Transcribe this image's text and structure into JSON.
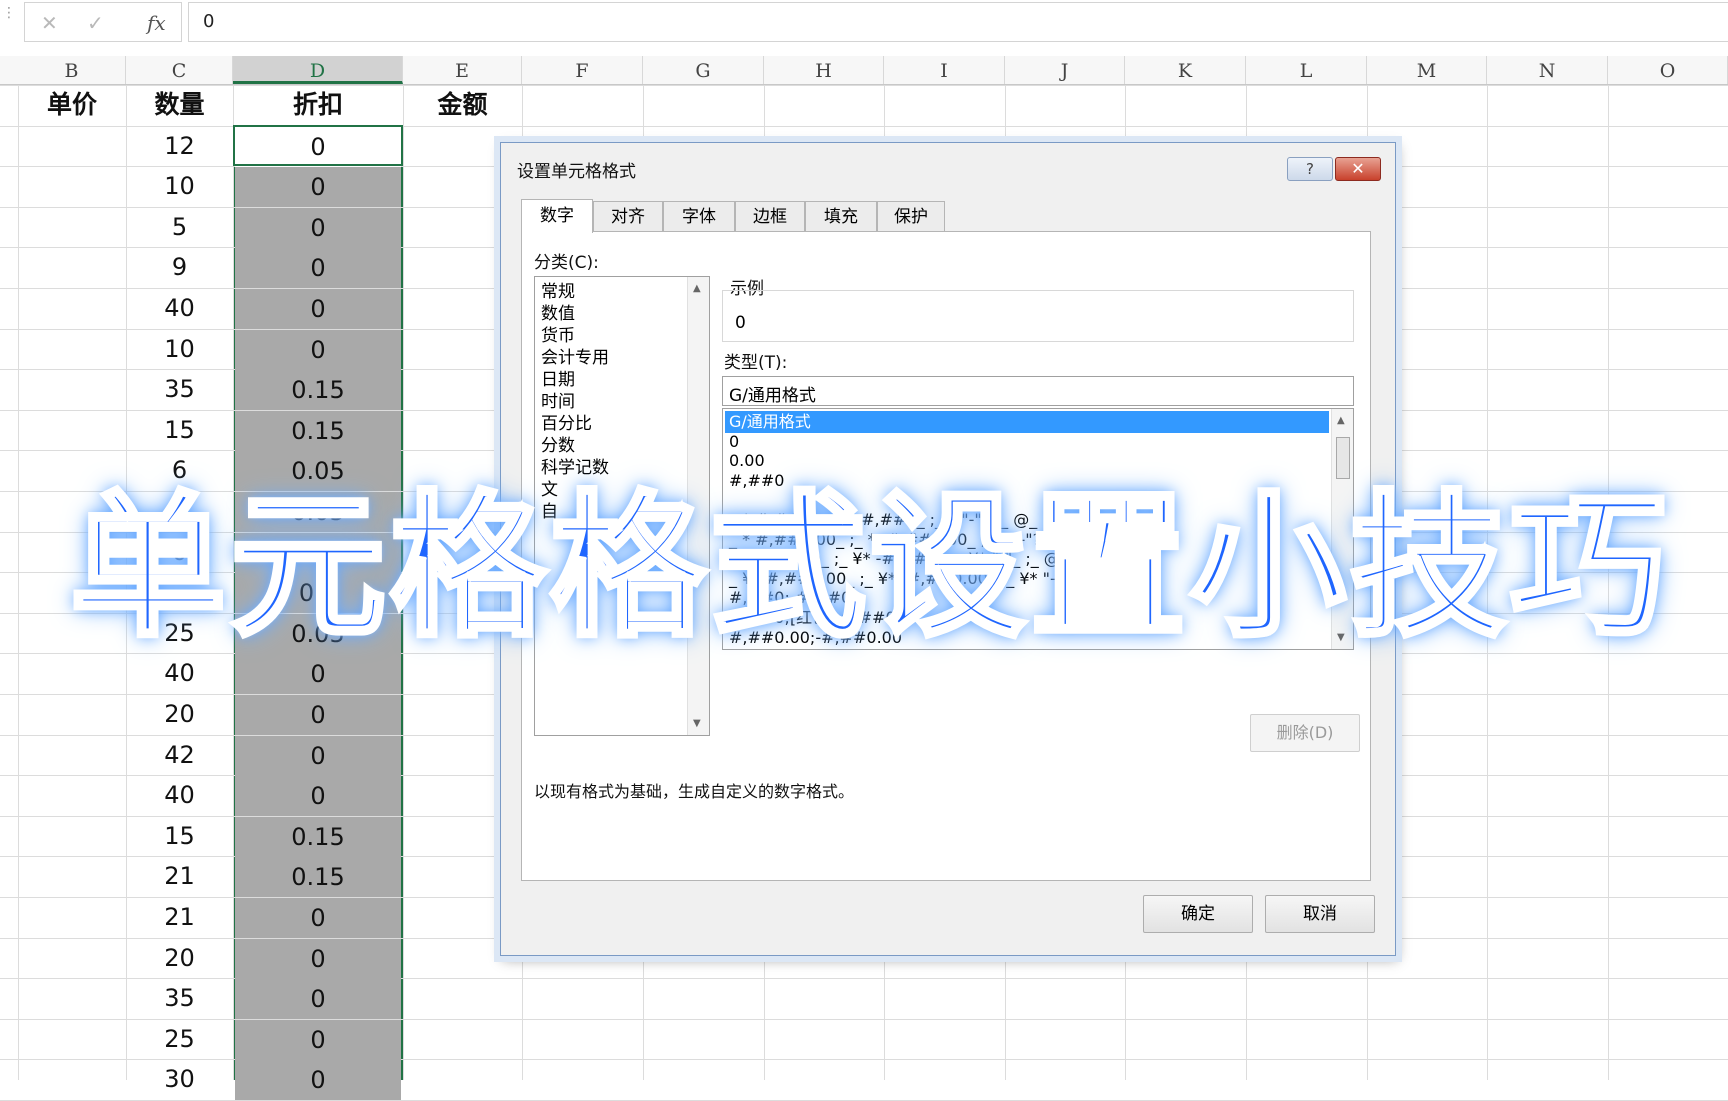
{
  "formula_bar": {
    "cancel_icon": "✕",
    "enter_icon": "✓",
    "fx_label": "fx",
    "value": "0"
  },
  "columns": [
    "B",
    "C",
    "D",
    "E",
    "F",
    "G",
    "H",
    "I",
    "J",
    "K",
    "L",
    "M",
    "N",
    "O"
  ],
  "selected_column": "D",
  "header_row": {
    "B": "单价",
    "C": "数量",
    "D": "折扣",
    "E": "金额"
  },
  "rows": [
    {
      "c": "12",
      "d": "0"
    },
    {
      "c": "10",
      "d": "0"
    },
    {
      "c": "5",
      "d": "0"
    },
    {
      "c": "9",
      "d": "0"
    },
    {
      "c": "40",
      "d": "0"
    },
    {
      "c": "10",
      "d": "0"
    },
    {
      "c": "35",
      "d": "0.15"
    },
    {
      "c": "15",
      "d": "0.15"
    },
    {
      "c": "6",
      "d": "0.05"
    },
    {
      "c": "5",
      "d": "0.05"
    },
    {
      "c": "0",
      "d": ""
    },
    {
      "c": "",
      "d": "0.1"
    },
    {
      "c": "25",
      "d": "0.05"
    },
    {
      "c": "40",
      "d": "0"
    },
    {
      "c": "20",
      "d": "0"
    },
    {
      "c": "42",
      "d": "0"
    },
    {
      "c": "40",
      "d": "0"
    },
    {
      "c": "15",
      "d": "0.15"
    },
    {
      "c": "21",
      "d": "0.15"
    },
    {
      "c": "21",
      "d": "0"
    },
    {
      "c": "20",
      "d": "0"
    },
    {
      "c": "35",
      "d": "0"
    },
    {
      "c": "25",
      "d": "0"
    },
    {
      "c": "30",
      "d": "0"
    }
  ],
  "dialog": {
    "title": "设置单元格格式",
    "help": "?",
    "close": "✕",
    "tabs": [
      "数字",
      "对齐",
      "字体",
      "边框",
      "填充",
      "保护"
    ],
    "category_label": "分类(C):",
    "categories": [
      "常规",
      "数值",
      "货币",
      "会计专用",
      "日期",
      "时间",
      "百分比",
      "分数",
      "科学记数",
      "文",
      "自"
    ],
    "sample_label": "示例",
    "sample_value": "0",
    "type_label": "类型(T):",
    "type_value": "G/通用格式",
    "type_list": [
      "G/通用格式",
      "0",
      "0.00",
      "#,##0",
      "",
      "_ * #,##0_ ;_ * -#,##0_ ;_ * \"-\"_ ;_ @_",
      "_ * #,##0.00_ ;_ * -#,##0.00_ ;_ * \"-\"??_ ;_ @_",
      "_ ¥* #,##0_ ;_ ¥* -#,##0_ ;_ ¥* \"-\"_ ;_ @_",
      "_ ¥* #,##0.00_ ;_ ¥* -#,##0.00_ ;_ ¥* \"-\"??_ ;_ @_",
      "#,##0;-#,##0",
      "#,##0;[红色]-#,##0",
      "#,##0.00;-#,##0.00"
    ],
    "delete_label": "删除(D)",
    "description": "以现有格式为基础，生成自定义的数字格式。",
    "ok_label": "确定",
    "cancel_label": "取消"
  },
  "overlay_title": "单元格格式设置小技巧"
}
